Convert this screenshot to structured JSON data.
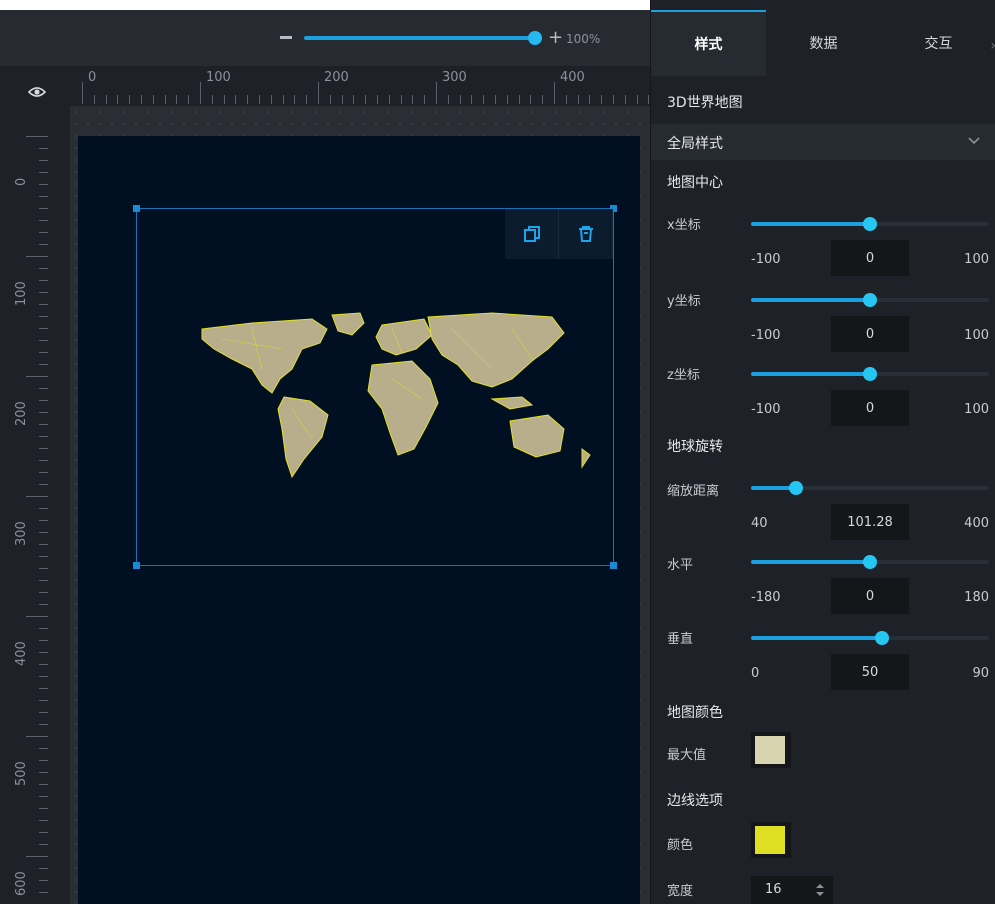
{
  "zoom": {
    "minus_icon": "minus-icon",
    "plus_icon": "plus-icon",
    "label": "100%",
    "level": 1.0
  },
  "ruler": {
    "h_labels": [
      "0",
      "100",
      "200",
      "300",
      "400"
    ],
    "v_labels": [
      "0",
      "100",
      "200",
      "300",
      "400",
      "500",
      "600"
    ]
  },
  "canvas": {
    "background": "#000f22",
    "accent": "#1a8ad6"
  },
  "widget": {
    "copy_icon": "copy-icon",
    "delete_icon": "trash-icon",
    "map_fill": "#b8ae8c",
    "map_border": "#e2e026"
  },
  "panel": {
    "tabs": [
      {
        "label": "样式"
      },
      {
        "label": "数据"
      },
      {
        "label": "交互"
      }
    ],
    "title": "3D世界地图",
    "section": "全局样式",
    "map_center": {
      "label": "地图中心",
      "x": {
        "label": "x坐标",
        "min": "-100",
        "value": "0",
        "max": "100",
        "ratio": 0.5
      },
      "y": {
        "label": "y坐标",
        "min": "-100",
        "value": "0",
        "max": "100",
        "ratio": 0.5
      },
      "z": {
        "label": "z坐标",
        "min": "-100",
        "value": "0",
        "max": "100",
        "ratio": 0.5
      }
    },
    "rotation": {
      "label": "地球旋转",
      "distance": {
        "label": "缩放距离",
        "min": "40",
        "value": "101.28",
        "max": "400",
        "ratio": 0.17
      },
      "horizontal": {
        "label": "水平",
        "min": "-180",
        "value": "0",
        "max": "180",
        "ratio": 0.5
      },
      "vertical": {
        "label": "垂直",
        "min": "0",
        "value": "50",
        "max": "90",
        "ratio": 0.555
      }
    },
    "map_color": {
      "label": "地图颜色",
      "max_label": "最大值",
      "max_color": "#d8d4b0"
    },
    "border": {
      "label": "边线选项",
      "color_label": "颜色",
      "color": "#dede22",
      "width_label": "宽度",
      "width": "16"
    }
  }
}
